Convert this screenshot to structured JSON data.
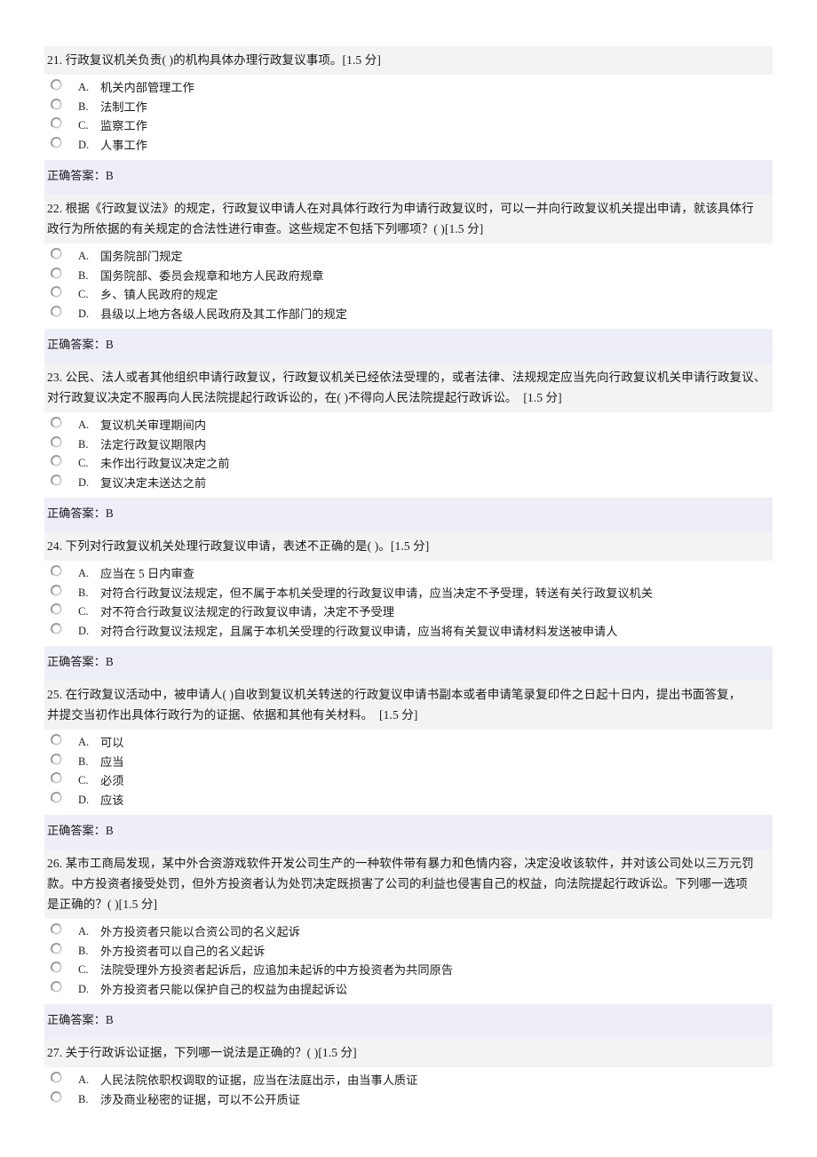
{
  "page": {
    "answer_label": "正确答案：",
    "score_tag": "[1.5 分]"
  },
  "questions": [
    {
      "id": "q21",
      "stem_lines": [
        "21. 行政复议机关负责( )的机构具体办理行政复议事项。[1.5 分]"
      ],
      "options": [
        {
          "label": "A.",
          "text": "机关内部管理工作"
        },
        {
          "label": "B.",
          "text": "法制工作"
        },
        {
          "label": "C.",
          "text": "监察工作"
        },
        {
          "label": "D.",
          "text": "人事工作"
        }
      ],
      "answer": "正确答案：B"
    },
    {
      "id": "q22",
      "stem_lines": [
        "22. 根据《行政复议法》的规定，行政复议申请人在对具体行政行为申请行政复议时，可以一并向行政复议机关提出申请，就该具体行",
        "政行为所依据的有关规定的合法性进行审查。这些规定不包括下列哪项？( )[1.5 分]"
      ],
      "options": [
        {
          "label": "A.",
          "text": "国务院部门规定"
        },
        {
          "label": "B.",
          "text": "国务院部、委员会规章和地方人民政府规章"
        },
        {
          "label": "C.",
          "text": "乡、镇人民政府的规定"
        },
        {
          "label": "D.",
          "text": "县级以上地方各级人民政府及其工作部门的规定"
        }
      ],
      "answer": "正确答案：B"
    },
    {
      "id": "q23",
      "stem_lines": [
        "23. 公民、法人或者其他组织申请行政复议，行政复议机关已经依法受理的，或者法律、法规规定应当先向行政复议机关申请行政复议、",
        "对行政复议决定不服再向人民法院提起行政诉讼的，在( )不得向人民法院提起行政诉讼。　[1.5 分]"
      ],
      "options": [
        {
          "label": "A.",
          "text": "复议机关审理期间内"
        },
        {
          "label": "B.",
          "text": "法定行政复议期限内"
        },
        {
          "label": "C.",
          "text": "未作出行政复议决定之前"
        },
        {
          "label": "D.",
          "text": "复议决定未送达之前"
        }
      ],
      "answer": "正确答案：B"
    },
    {
      "id": "q24",
      "stem_lines": [
        "24. 下列对行政复议机关处理行政复议申请，表述不正确的是( )。[1.5 分]"
      ],
      "options": [
        {
          "label": "A.",
          "text": "应当在 5 日内审查"
        },
        {
          "label": "B.",
          "text": "对符合行政复议法规定，但不属于本机关受理的行政复议申请，应当决定不予受理，转送有关行政复议机关"
        },
        {
          "label": "C.",
          "text": "对不符合行政复议法规定的行政复议申请，决定不予受理"
        },
        {
          "label": "D.",
          "text": "对符合行政复议法规定，且属于本机关受理的行政复议申请，应当将有关复议申请材料发送被申请人"
        }
      ],
      "answer": "正确答案：B"
    },
    {
      "id": "q25",
      "stem_lines": [
        "25. 在行政复议活动中，被申请人( )自收到复议机关转送的行政复议申请书副本或者申请笔录复印件之日起十日内，提出书面答复，",
        "并提交当初作出具体行政行为的证据、依据和其他有关材料。　[1.5 分]"
      ],
      "options": [
        {
          "label": "A.",
          "text": "可以"
        },
        {
          "label": "B.",
          "text": "应当"
        },
        {
          "label": "C.",
          "text": "必须"
        },
        {
          "label": "D.",
          "text": "应该"
        }
      ],
      "answer": "正确答案：B"
    },
    {
      "id": "q26",
      "stem_lines": [
        "26. 某市工商局发现，某中外合资游戏软件开发公司生产的一种软件带有暴力和色情内容，决定没收该软件，并对该公司处以三万元罚",
        "款。中方投资者接受处罚，但外方投资者认为处罚决定既损害了公司的利益也侵害自己的权益，向法院提起行政诉讼。下列哪一选项",
        "是正确的？( )[1.5 分]"
      ],
      "options": [
        {
          "label": "A.",
          "text": "外方投资者只能以合资公司的名义起诉"
        },
        {
          "label": "B.",
          "text": "外方投资者可以自己的名义起诉"
        },
        {
          "label": "C.",
          "text": "法院受理外方投资者起诉后，应追加未起诉的中方投资者为共同原告"
        },
        {
          "label": "D.",
          "text": "外方投资者只能以保护自己的权益为由提起诉讼"
        }
      ],
      "answer": "正确答案：B"
    },
    {
      "id": "q27",
      "stem_lines": [
        "27. 关于行政诉讼证据，下列哪一说法是正确的？( )[1.5 分]"
      ],
      "options": [
        {
          "label": "A.",
          "text": "人民法院依职权调取的证据，应当在法庭出示，由当事人质证"
        },
        {
          "label": "B.",
          "text": "涉及商业秘密的证据，可以不公开质证"
        }
      ],
      "answer": null
    }
  ],
  "colors": {
    "stem_bg": "#f3f3f3",
    "answer_bg": "#eeeef9",
    "page_bg": "#ffffff",
    "text": "#1b1b1b"
  }
}
